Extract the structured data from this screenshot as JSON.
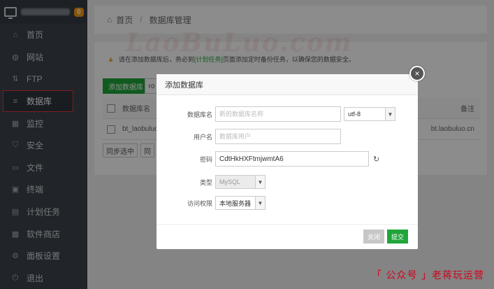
{
  "sidebar": {
    "badge": "0",
    "items": [
      {
        "label": "首页",
        "icon": "home-icon"
      },
      {
        "label": "网站",
        "icon": "globe-icon"
      },
      {
        "label": "FTP",
        "icon": "ftp-icon"
      },
      {
        "label": "数据库",
        "icon": "database-icon"
      },
      {
        "label": "监控",
        "icon": "monitor-icon"
      },
      {
        "label": "安全",
        "icon": "shield-icon"
      },
      {
        "label": "文件",
        "icon": "folder-icon"
      },
      {
        "label": "终端",
        "icon": "terminal-icon"
      },
      {
        "label": "计划任务",
        "icon": "calendar-icon"
      },
      {
        "label": "软件商店",
        "icon": "store-icon"
      },
      {
        "label": "面板设置",
        "icon": "gear-icon"
      },
      {
        "label": "退出",
        "icon": "logout-icon"
      }
    ]
  },
  "breadcrumb": {
    "home": "首页",
    "sep": "/",
    "current": "数据库管理"
  },
  "notice": {
    "prefix": "请在添加数据库后，务必到",
    "link": "[计划任务]",
    "suffix": "页面添加定时备份任务，以确保您的数据安全。"
  },
  "toolbar": {
    "add_db": "添加数据库",
    "root_btn": "ro"
  },
  "table": {
    "headers": {
      "name": "数据库名",
      "note": "备注"
    },
    "rows": [
      {
        "name": "bt_laobuluo",
        "note": "bt.laobuluo.cn"
      }
    ]
  },
  "footer_btns": {
    "sync_selected": "同步选中",
    "sync_all": "同"
  },
  "dialog": {
    "title": "添加数据库",
    "close_icon": "×",
    "fields": {
      "db_name": {
        "label": "数据库名",
        "placeholder": "新的数据库名称",
        "charset": "utf-8"
      },
      "user": {
        "label": "用户名",
        "placeholder": "数据库用户"
      },
      "password": {
        "label": "密码",
        "value": "CdtHkHXFtmjwmtA6"
      },
      "type": {
        "label": "类型",
        "value": "MySQL"
      },
      "access": {
        "label": "访问权限",
        "value": "本地服务器"
      }
    },
    "buttons": {
      "close": "关闭",
      "submit": "提交"
    }
  },
  "brand": "「 公众号 」老蒋玩运营"
}
